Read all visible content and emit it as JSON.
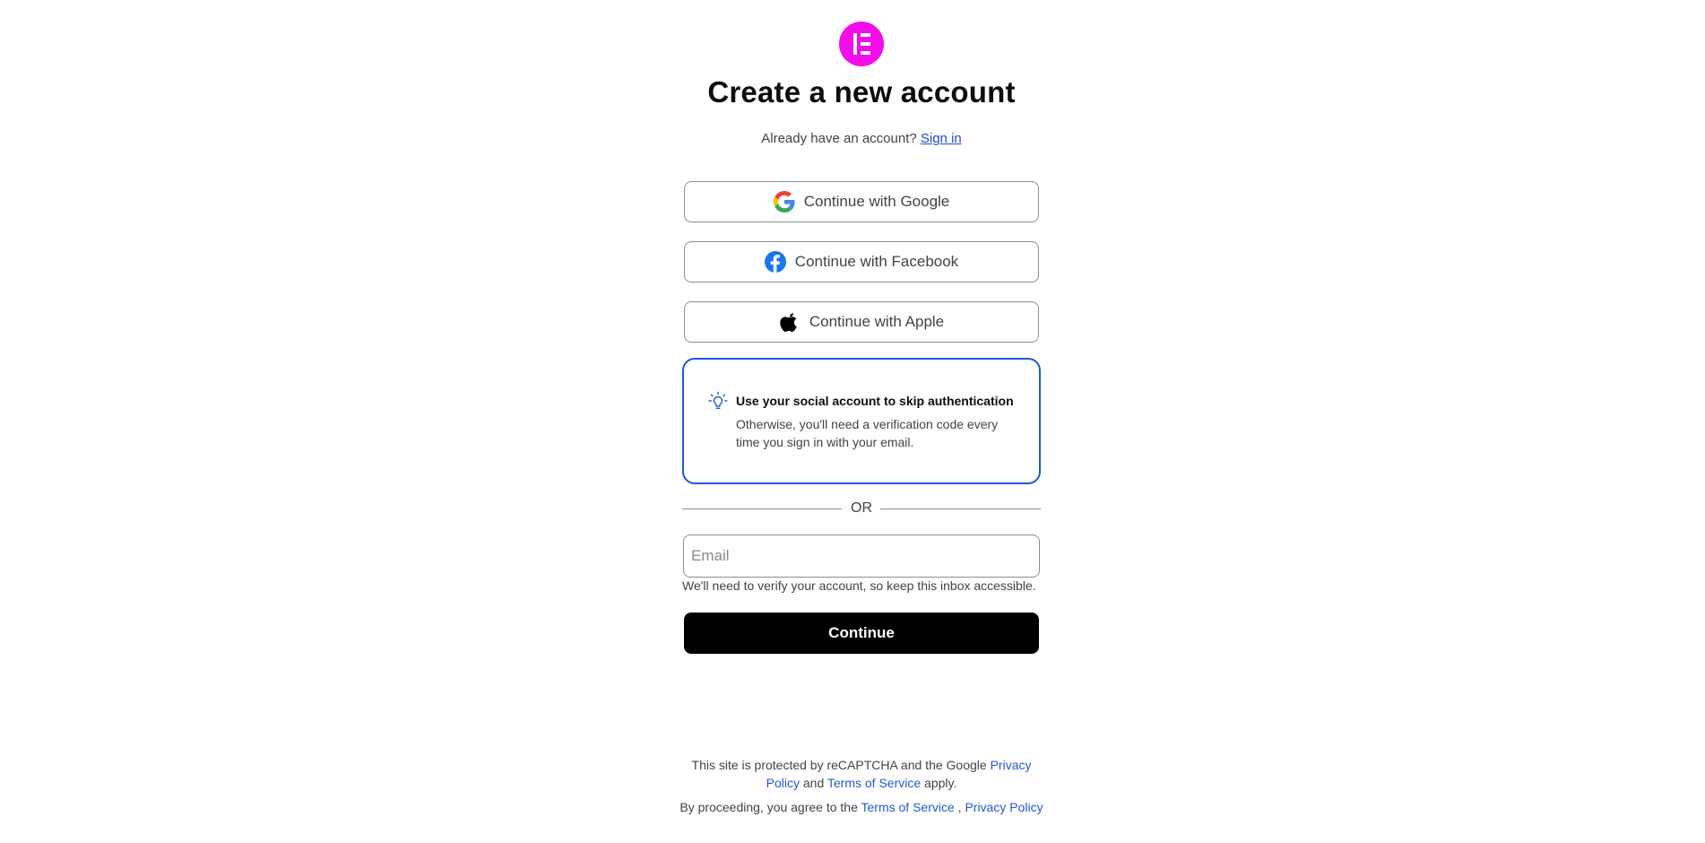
{
  "colors": {
    "logo": "#f20ee8",
    "link": "#2457d6",
    "info_border": "#1f5ad8",
    "primary_button": "#000000"
  },
  "header": {
    "logo_icon": "elementor-logo-icon",
    "title": "Create a new account",
    "already_text": "Already have an account?",
    "sign_in_link": "Sign in"
  },
  "social": {
    "google": {
      "label": "Continue with Google",
      "icon": "google-icon"
    },
    "facebook": {
      "label": "Continue with Facebook",
      "icon": "facebook-icon"
    },
    "apple": {
      "label": "Continue with Apple",
      "icon": "apple-icon"
    }
  },
  "info": {
    "icon": "lightbulb-icon",
    "title": "Use your social account to skip authentication",
    "text": "Otherwise, you'll need a verification code every time you sign in with your email."
  },
  "divider": {
    "label": "OR"
  },
  "email": {
    "placeholder": "Email",
    "value": "",
    "hint": "We'll need to verify your account, so keep this inbox accessible."
  },
  "continue_label": "Continue",
  "footer": {
    "recaptcha_prefix": "This site is protected by reCAPTCHA and the Google",
    "recaptcha_privacy": "Privacy Policy",
    "recaptcha_and": "and",
    "recaptcha_terms": "Terms of Service",
    "recaptcha_suffix": "apply.",
    "agree_prefix": "By proceeding, you agree to the",
    "agree_terms": "Terms of Service",
    "agree_sep": ",",
    "agree_privacy": "Privacy Policy"
  }
}
